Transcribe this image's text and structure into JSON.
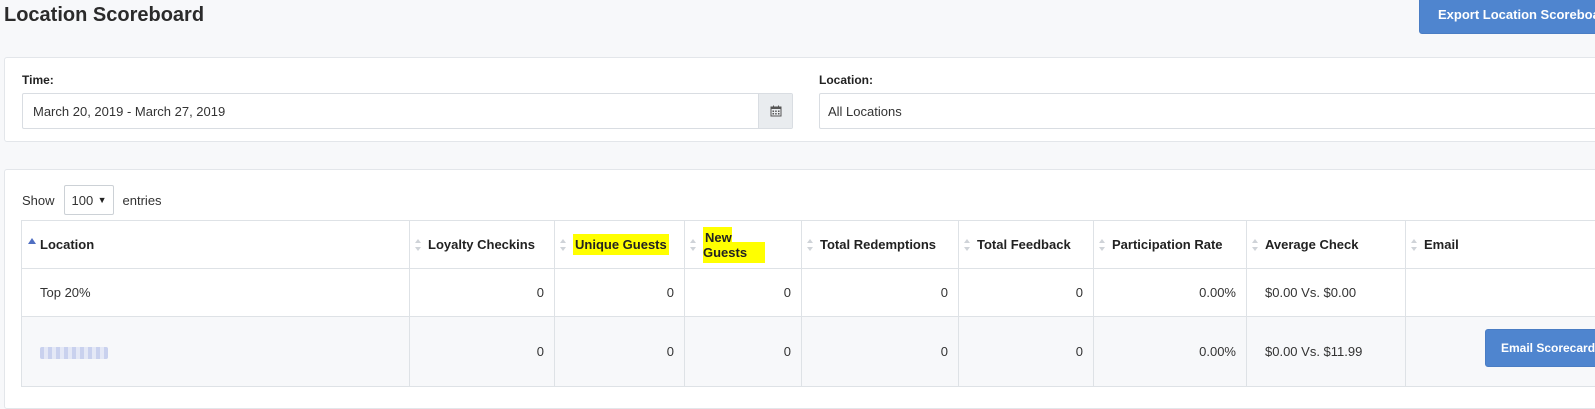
{
  "header": {
    "title": "Location Scoreboard",
    "export_label": "Export Location Scoreboard"
  },
  "filters": {
    "time_label": "Time:",
    "time_value": "March 20, 2019 - March 27, 2019",
    "location_label": "Location:",
    "location_value": "All Locations"
  },
  "table_controls": {
    "show_label": "Show",
    "entries_value": "100",
    "entries_label": "entries"
  },
  "table": {
    "columns": [
      "Location",
      "Loyalty Checkins",
      "Unique Guests",
      "New Guests",
      "Total Redemptions",
      "Total Feedback",
      "Participation Rate",
      "Average Check",
      "Email"
    ],
    "rows": [
      {
        "location": "Top 20%",
        "loyalty_checkins": "0",
        "unique_guests": "0",
        "new_guests": "0",
        "total_redemptions": "0",
        "total_feedback": "0",
        "participation_rate": "0.00%",
        "average_check": "$0.00 Vs. $0.00",
        "email": ""
      },
      {
        "location": "",
        "loyalty_checkins": "0",
        "unique_guests": "0",
        "new_guests": "0",
        "total_redemptions": "0",
        "total_feedback": "0",
        "participation_rate": "0.00%",
        "average_check": "$0.00 Vs. $11.99",
        "email": "Email Scorecard"
      }
    ]
  },
  "colors": {
    "accent": "#4f85cf",
    "highlight": "#ffff00",
    "sort_active": "#4f6fc2"
  },
  "icons": {
    "calendar": "calendar-icon",
    "sort": "sort-icon"
  }
}
